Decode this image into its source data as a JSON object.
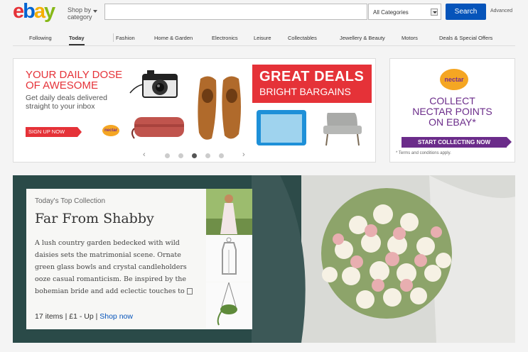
{
  "header": {
    "logo": {
      "e": "e",
      "b": "b",
      "a": "a",
      "y": "y"
    },
    "shop_by": "Shop by",
    "category": "category",
    "search_placeholder": "",
    "category_select": "All Categories",
    "search_button": "Search",
    "advanced": "Advanced"
  },
  "nav": {
    "items": [
      {
        "label": "Following"
      },
      {
        "label": "Today"
      },
      {
        "label": "Fashion"
      },
      {
        "label": "Home & Garden"
      },
      {
        "label": "Electronics"
      },
      {
        "label": "Leisure"
      },
      {
        "label": "Collectables"
      },
      {
        "label": "Jewellery & Beauty"
      },
      {
        "label": "Motors"
      },
      {
        "label": "Deals & Special Offers"
      }
    ],
    "active": "Today"
  },
  "carousel": {
    "headline_1": "YOUR DAILY DOSE",
    "headline_2": "OF AWESOME",
    "sub_1": "Get daily deals delivered",
    "sub_2": "straight to your inbox",
    "signup": "SIGN UP NOW",
    "nectar_badge": "nectar",
    "deals_1": "GREAT DEALS",
    "deals_2": "BRIGHT BARGAINS",
    "dot_count": 5,
    "active_dot": 3,
    "colors": {
      "red": "#e53238"
    }
  },
  "nectar": {
    "logo": "nectar",
    "line_1": "COLLECT",
    "line_2": "NECTAR POINTS",
    "line_3": "ON EBAY*",
    "button": "START COLLECTING NOW",
    "terms": "* Terms and conditions apply.",
    "colors": {
      "purple": "#6b2c8a",
      "orange": "#f5a623"
    }
  },
  "hero": {
    "kicker": "Today's Top Collection",
    "title": "Far From Shabby",
    "body": "A lush country garden bedecked with wild daisies sets the matrimonial scene. Ornate green glass bowls and crystal candleholders ooze casual romanticism. Be inspired by the bohemian bride and add eclectic touches to",
    "items": "17 items",
    "price": "£1 - Up",
    "shop_now": "Shop now"
  }
}
